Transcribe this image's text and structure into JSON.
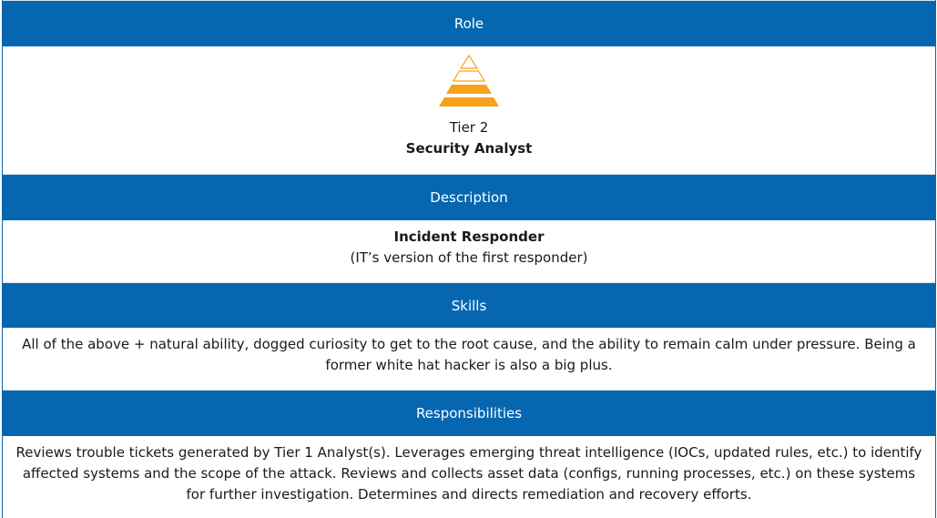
{
  "headers": {
    "role": "Role",
    "description": "Description",
    "skills": "Skills",
    "responsibilities": "Responsibilities"
  },
  "role": {
    "icon": "pyramid-tier-icon",
    "tier": "Tier 2",
    "title": "Security Analyst",
    "accent_color": "#f7a21b"
  },
  "description": {
    "title": "Incident Responder",
    "subtitle": "(IT’s version of the first responder)"
  },
  "skills": {
    "text": "All of the above + natural ability, dogged curiosity to get to the root cause, and the ability to remain calm under pressure. Being a former white hat hacker is also a big plus."
  },
  "responsibilities": {
    "text": "Reviews trouble tickets generated by Tier 1 Analyst(s). Leverages emerging threat intelligence (IOCs, updated rules, etc.) to identify affected systems and the scope of the attack. Reviews and collects asset data (configs, running processes, etc.) on these systems for further investigation. Determines and directs remediation and recovery efforts."
  },
  "colors": {
    "header_bg": "#0667b0",
    "header_text": "#ffffff"
  }
}
